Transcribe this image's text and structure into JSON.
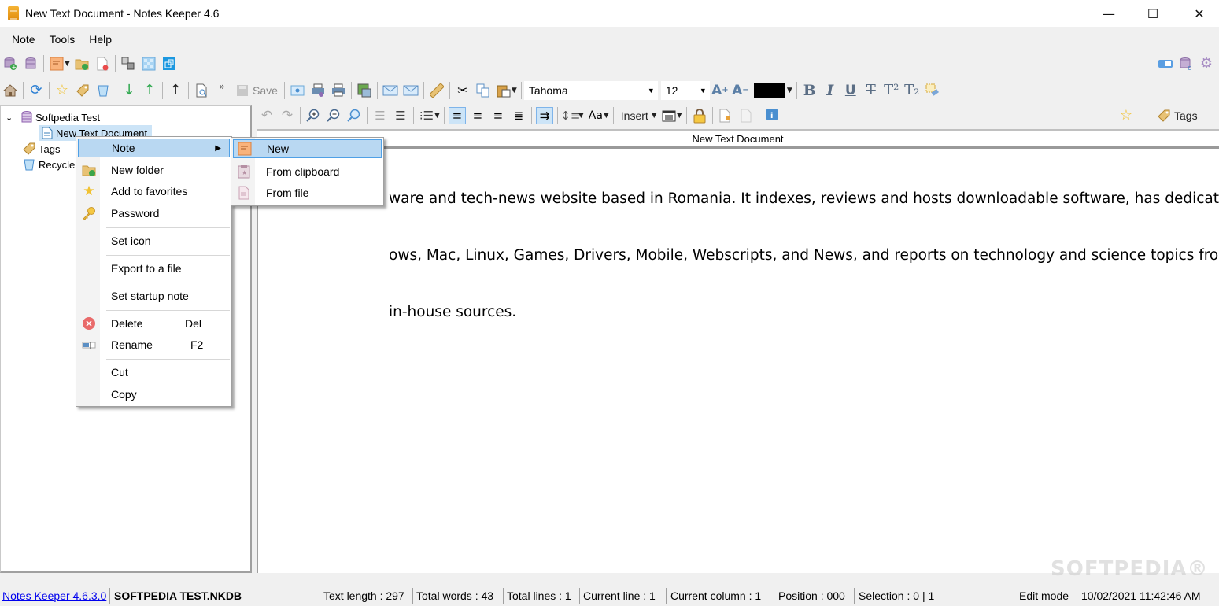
{
  "window": {
    "title": "New Text Document - Notes Keeper 4.6",
    "controls": {
      "minimize": "—",
      "maximize": "☐",
      "close": "✕"
    }
  },
  "menubar": [
    "Note",
    "Tools",
    "Help"
  ],
  "toolbar1": {
    "icons": [
      "new-database-icon",
      "open-database-icon",
      "new-note-icon",
      "new-folder-icon",
      "delete-note-icon",
      "copy-structure-icon",
      "transparency-icon",
      "always-on-top-icon"
    ],
    "right_icons": [
      "toggle-panel-icon",
      "database-sync-icon",
      "settings-icon"
    ]
  },
  "toolbar2": {
    "save_label": "Save",
    "overflow": "»",
    "font_name": "Tahoma",
    "font_size": "12",
    "text_color": "#000000",
    "format_buttons": [
      "B",
      "I",
      "U",
      "T",
      "T²",
      "T₂"
    ]
  },
  "toolbar3": {
    "insert_label": "Insert",
    "tags_label": "Tags"
  },
  "tree": {
    "root": "Softpedia Test",
    "child": "New Text Document",
    "tags": "Tags",
    "recycle": "Recycle"
  },
  "document": {
    "title": "New Text Document",
    "lines": [
      "ware and tech-news website based in Romania. It indexes, reviews and hosts downloadable software, has dedicated",
      "ows, Mac, Linux, Games, Drivers, Mobile, Webscripts, and News, and reports on technology and science topics from",
      "in-house sources."
    ]
  },
  "context_menu": {
    "items": [
      {
        "label": "Note",
        "icon": "",
        "submenu": true
      },
      {
        "label": "New folder",
        "icon": "new-folder-icon"
      },
      {
        "label": "Add to favorites",
        "icon": "star-icon"
      },
      {
        "label": "Password",
        "icon": "key-icon"
      },
      {
        "label": "Set icon"
      },
      {
        "label": "Export to a file"
      },
      {
        "label": "Set startup note"
      },
      {
        "label": "Delete",
        "shortcut": "Del",
        "icon": "delete-icon"
      },
      {
        "label": "Rename",
        "shortcut": "F2",
        "icon": "rename-icon"
      },
      {
        "label": "Cut"
      },
      {
        "label": "Copy"
      }
    ]
  },
  "submenu": {
    "items": [
      {
        "label": "New",
        "icon": "new-note-icon"
      },
      {
        "label": "From clipboard",
        "icon": "clipboard-icon"
      },
      {
        "label": "From file",
        "icon": "file-icon"
      }
    ]
  },
  "statusbar": {
    "version_link": "Notes Keeper 4.6.3.0",
    "database": "SOFTPEDIA TEST.NKDB",
    "text_length": "Text length : 297",
    "total_words": "Total words : 43",
    "total_lines": "Total lines : 1",
    "current_line": "Current line : 1",
    "current_column": "Current column : 1",
    "position": "Position : 000",
    "selection": "Selection : 0 | 1",
    "mode": "Edit mode",
    "datetime": "10/02/2021 11:42:46 AM"
  },
  "watermark": "SOFTPEDIA®"
}
